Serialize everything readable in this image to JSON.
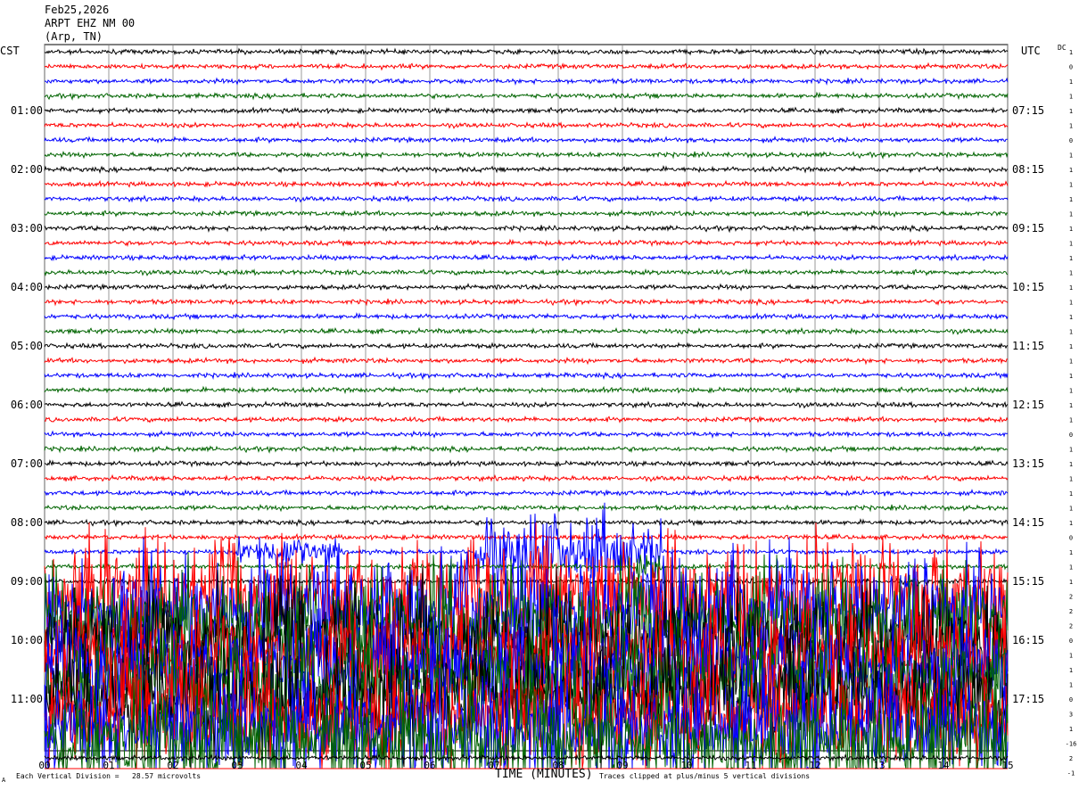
{
  "header": {
    "date": "Feb25,2026",
    "station": "ARPT EHZ NM 00",
    "location": "(Arp, TN)"
  },
  "axes": {
    "left_tz": "CST",
    "right_tz": "UTC",
    "dc_label": "DC",
    "x_title": "TIME (MINUTES)"
  },
  "footer": {
    "scale_note": "Each Vertical Division =   28.57 microvolts",
    "clip_note": "Traces clipped at plus/minus 5 vertical divisions",
    "corner_mark": "A"
  },
  "chart_data": {
    "type": "helicorder",
    "x_ticks": [
      "00",
      "01",
      "02",
      "03",
      "04",
      "05",
      "06",
      "07",
      "08",
      "09",
      "10",
      "11",
      "12",
      "13",
      "14",
      "15"
    ],
    "xlim": [
      0,
      15
    ],
    "rows_per_hour": 4,
    "left_hour_labels": [
      "01:00",
      "02:00",
      "03:00",
      "04:00",
      "05:00",
      "06:00",
      "07:00",
      "08:00",
      "09:00",
      "10:00",
      "11:00"
    ],
    "right_hour_labels": [
      "07:15",
      "08:15",
      "09:15",
      "10:15",
      "11:15",
      "12:15",
      "13:15",
      "14:15",
      "15:15",
      "16:15",
      "17:15"
    ],
    "trace_colors": [
      "#000000",
      "#ff0000",
      "#0000ff",
      "#006400"
    ],
    "dc_offsets": [
      "1",
      "0",
      "1",
      "1",
      "1",
      "1",
      "0",
      "1",
      "1",
      "1",
      "1",
      "1",
      "1",
      "1",
      "1",
      "1",
      "1",
      "1",
      "1",
      "1",
      "1",
      "1",
      "1",
      "1",
      "1",
      "1",
      "0",
      "1",
      "1",
      "1",
      "1",
      "1",
      "1",
      "0",
      "1",
      "1",
      "1",
      "2",
      "2",
      "2",
      "0",
      "1",
      "1",
      "1",
      "0",
      "3",
      "1",
      "-16",
      "2",
      "-1"
    ],
    "activity": [
      {
        "row": 34,
        "from_min": 3.0,
        "to_min": 4.6,
        "level": "moderate"
      },
      {
        "row": 34,
        "from_min": 6.7,
        "to_min": 9.6,
        "level": "strong"
      },
      {
        "row": 35,
        "from_min": 9.2,
        "to_min": 9.6,
        "level": "moderate"
      },
      {
        "row": 37,
        "from_min": 0.0,
        "to_min": 15.0,
        "level": "clipped"
      },
      {
        "row": 38,
        "from_min": 0.0,
        "to_min": 15.0,
        "level": "clipped"
      },
      {
        "row": 39,
        "from_min": 0.0,
        "to_min": 15.0,
        "level": "clipped"
      },
      {
        "row": 40,
        "from_min": 0.0,
        "to_min": 15.0,
        "level": "clipped"
      },
      {
        "row": 41,
        "from_min": 0.0,
        "to_min": 15.0,
        "level": "clipped"
      },
      {
        "row": 42,
        "from_min": 0.0,
        "to_min": 15.0,
        "level": "clipped"
      },
      {
        "row": 43,
        "from_min": 0.0,
        "to_min": 15.0,
        "level": "clipped"
      },
      {
        "row": 44,
        "from_min": 0.0,
        "to_min": 15.0,
        "level": "clipped"
      },
      {
        "row": 45,
        "from_min": 0.0,
        "to_min": 15.0,
        "level": "clipped"
      },
      {
        "row": 46,
        "from_min": 0.0,
        "to_min": 15.0,
        "level": "clipped"
      },
      {
        "row": 47,
        "from_min": 0.0,
        "to_min": 15.0,
        "level": "clipped"
      }
    ]
  }
}
